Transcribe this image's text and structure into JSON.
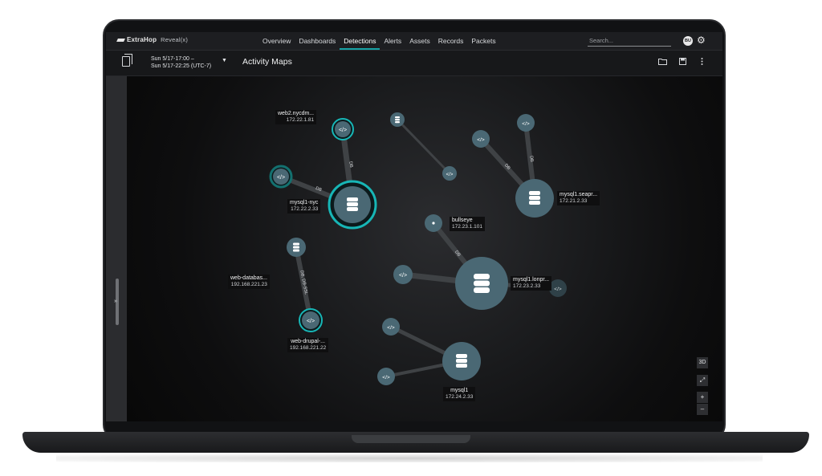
{
  "app": {
    "brand": "ExtraHop",
    "product": "Reveal(x)"
  },
  "nav": {
    "tabs": [
      "Overview",
      "Dashboards",
      "Detections",
      "Alerts",
      "Assets",
      "Records",
      "Packets"
    ],
    "active": "Detections",
    "search_placeholder": "Search...",
    "user_initials": "BU"
  },
  "header": {
    "time_start": "Sun 5/17-17:00 –",
    "time_end": "Sun 5/17-22:25 (UTC-7)",
    "title": "Activity Maps"
  },
  "colors": {
    "accent": "#17a3a5",
    "node": "#4a6874",
    "edge": "#3f4245"
  },
  "map": {
    "nodes": [
      {
        "id": "web2",
        "name": "web2.nycdm...",
        "ip": "172.22.1.81",
        "icon": "code-icon",
        "highlight": true
      },
      {
        "id": "mysql1nyc",
        "name": "mysql1-nyc",
        "ip": "172.22.2.33",
        "icon": "database-icon",
        "highlight": true
      },
      {
        "id": "webdb",
        "name": "web-databas...",
        "ip": "192.168.221.23",
        "icon": "database-icon",
        "highlight": false
      },
      {
        "id": "webdrupal",
        "name": "web-drupal-...",
        "ip": "192.168.221.22",
        "icon": "code-icon",
        "highlight": true
      },
      {
        "id": "bullseye",
        "name": "bullseye",
        "ip": "172.23.1.101",
        "icon": "dot-icon",
        "highlight": false
      },
      {
        "id": "mysqllon",
        "name": "mysql1.lonpr...",
        "ip": "172.23.2.33",
        "icon": "database-icon",
        "highlight": false
      },
      {
        "id": "mysqlsea",
        "name": "mysql1.seapr...",
        "ip": "172.21.2.33",
        "icon": "database-icon",
        "highlight": false
      },
      {
        "id": "mysql1",
        "name": "mysql1",
        "ip": "172.24.2.33",
        "icon": "database-icon",
        "highlight": false
      }
    ],
    "edge_labels": [
      "DB",
      "DB",
      "DB",
      "DB",
      "DB",
      "DB, DB-SSL"
    ]
  },
  "controls": {
    "view3d": "3D",
    "zoom_in": "+",
    "zoom_out": "–"
  }
}
